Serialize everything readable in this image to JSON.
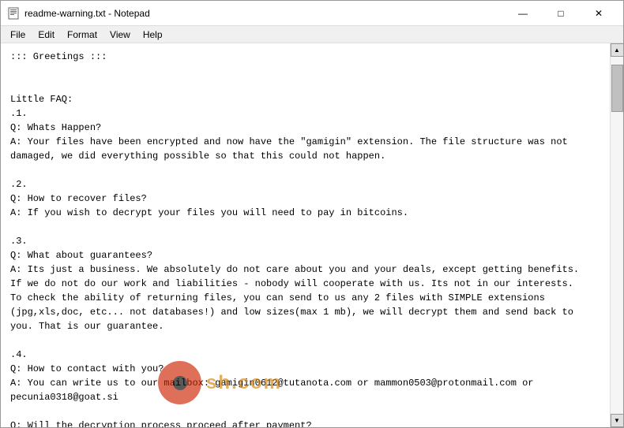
{
  "window": {
    "title": "readme-warning.txt - Notepad",
    "icon": "📄"
  },
  "menu": {
    "items": [
      "File",
      "Edit",
      "Format",
      "View",
      "Help"
    ]
  },
  "controls": {
    "minimize": "—",
    "maximize": "□",
    "close": "✕"
  },
  "content": {
    "text": "::: Greetings :::\n\n\nLittle FAQ:\n.1.\nQ: Whats Happen?\nA: Your files have been encrypted and now have the \"gamigin\" extension. The file structure was not\ndamaged, we did everything possible so that this could not happen.\n\n.2.\nQ: How to recover files?\nA: If you wish to decrypt your files you will need to pay in bitcoins.\n\n.3.\nQ: What about guarantees?\nA: Its just a business. We absolutely do not care about you and your deals, except getting benefits.\nIf we do not do our work and liabilities - nobody will cooperate with us. Its not in our interests.\nTo check the ability of returning files, you can send to us any 2 files with SIMPLE extensions\n(jpg,xls,doc, etc... not databases!) and low sizes(max 1 mb), we will decrypt them and send back to\nyou. That is our guarantee.\n\n.4.\nQ: How to contact with you?\nA: You can write us to our mailbox: gamigin0612@tutanota.com or mammon0503@protonmail.com or\npecunia0318@goat.si\n\nQ: Will the decryption process proceed after payment?\nA: After payment we will send to you our scanner-decoder program and detailed instructions for use.\nWith this program you will be able to decrypt all your encrypted files."
  }
}
